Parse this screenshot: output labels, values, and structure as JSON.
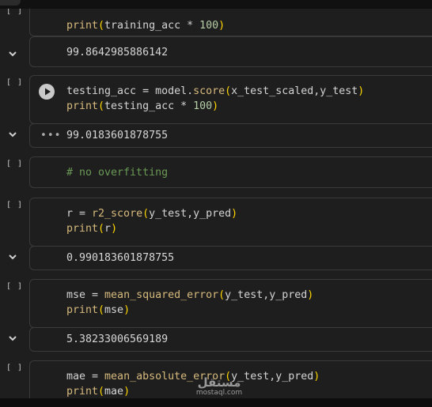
{
  "cells": [
    {
      "id": "c1",
      "count": "[ ]",
      "code": [
        "print(training_acc * 100)"
      ],
      "output": "99.8642985886142"
    },
    {
      "id": "c2",
      "count": "[ ]",
      "code": [
        "testing_acc = model.score(x_test_scaled,y_test)",
        "print(testing_acc * 100)"
      ],
      "output": "99.0183601878755",
      "output_prefix": "•••"
    },
    {
      "id": "c3",
      "count": "[ ]",
      "code": [
        "# no overfitting"
      ]
    },
    {
      "id": "c4",
      "count": "[ ]",
      "code": [
        "r = r2_score(y_test,y_pred)",
        "print(r)"
      ],
      "output": "0.990183601878755"
    },
    {
      "id": "c5",
      "count": "[ ]",
      "code": [
        "mse = mean_squared_error(y_test,y_pred)",
        "print(mse)"
      ],
      "output": "5.38233006569189"
    },
    {
      "id": "c6",
      "count": "[ ]",
      "code": [
        "mae = mean_absolute_error(y_test,y_pred)",
        "print(mae)"
      ]
    }
  ],
  "watermark": {
    "arabic": "مستقل",
    "latin": "mostaql.com"
  },
  "icons": {
    "run": "play-icon",
    "collapse": "chevron-down-icon",
    "more": "ellipsis-icon"
  }
}
